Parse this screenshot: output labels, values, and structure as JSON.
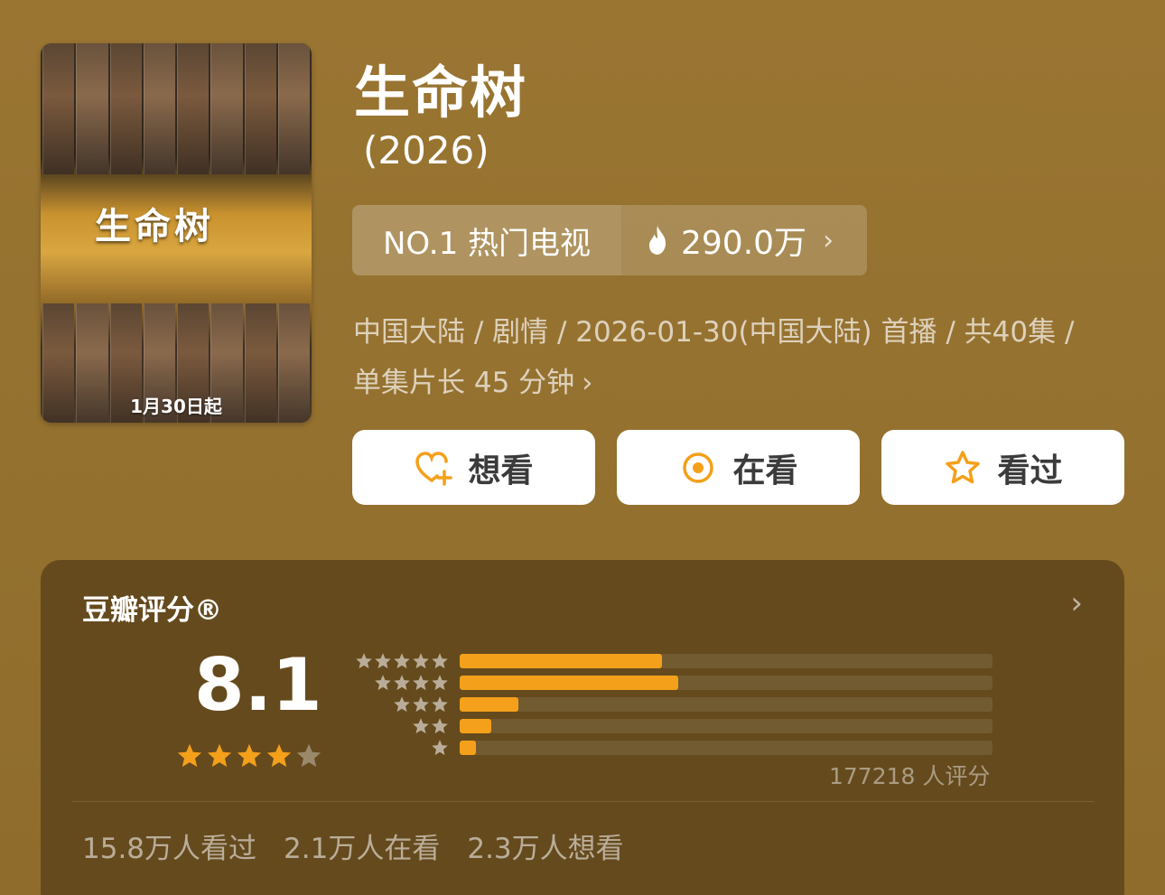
{
  "poster": {
    "logo_text": "生命树",
    "date_text": "1月30日起"
  },
  "title": "生命树",
  "year": "(2026)",
  "rank": {
    "label": "NO.1 热门电视",
    "heat": "290.0万",
    "heat_icon": "fire-icon"
  },
  "meta": {
    "line1": "中国大陆 / 剧情 / 2026-01-30(中国大陆) 首播 / 共40集 /",
    "line2": "单集片长 45 分钟"
  },
  "actions": [
    {
      "label": "想看",
      "icon": "heart-plus-icon"
    },
    {
      "label": "在看",
      "icon": "target-icon"
    },
    {
      "label": "看过",
      "icon": "star-outline-icon"
    }
  ],
  "rating": {
    "title": "豆瓣评分®",
    "score": "8.1",
    "stars_out_of_5": 4,
    "distribution_percent": [
      38,
      41,
      11,
      6,
      3
    ],
    "raters": "177218 人评分"
  },
  "stats": {
    "watched": "15.8万人看过",
    "watching": "2.1万人在看",
    "want": "2.3万人想看"
  },
  "colors": {
    "background": "#96712f",
    "card": "#654a1d",
    "accent": "#f4a01a"
  }
}
